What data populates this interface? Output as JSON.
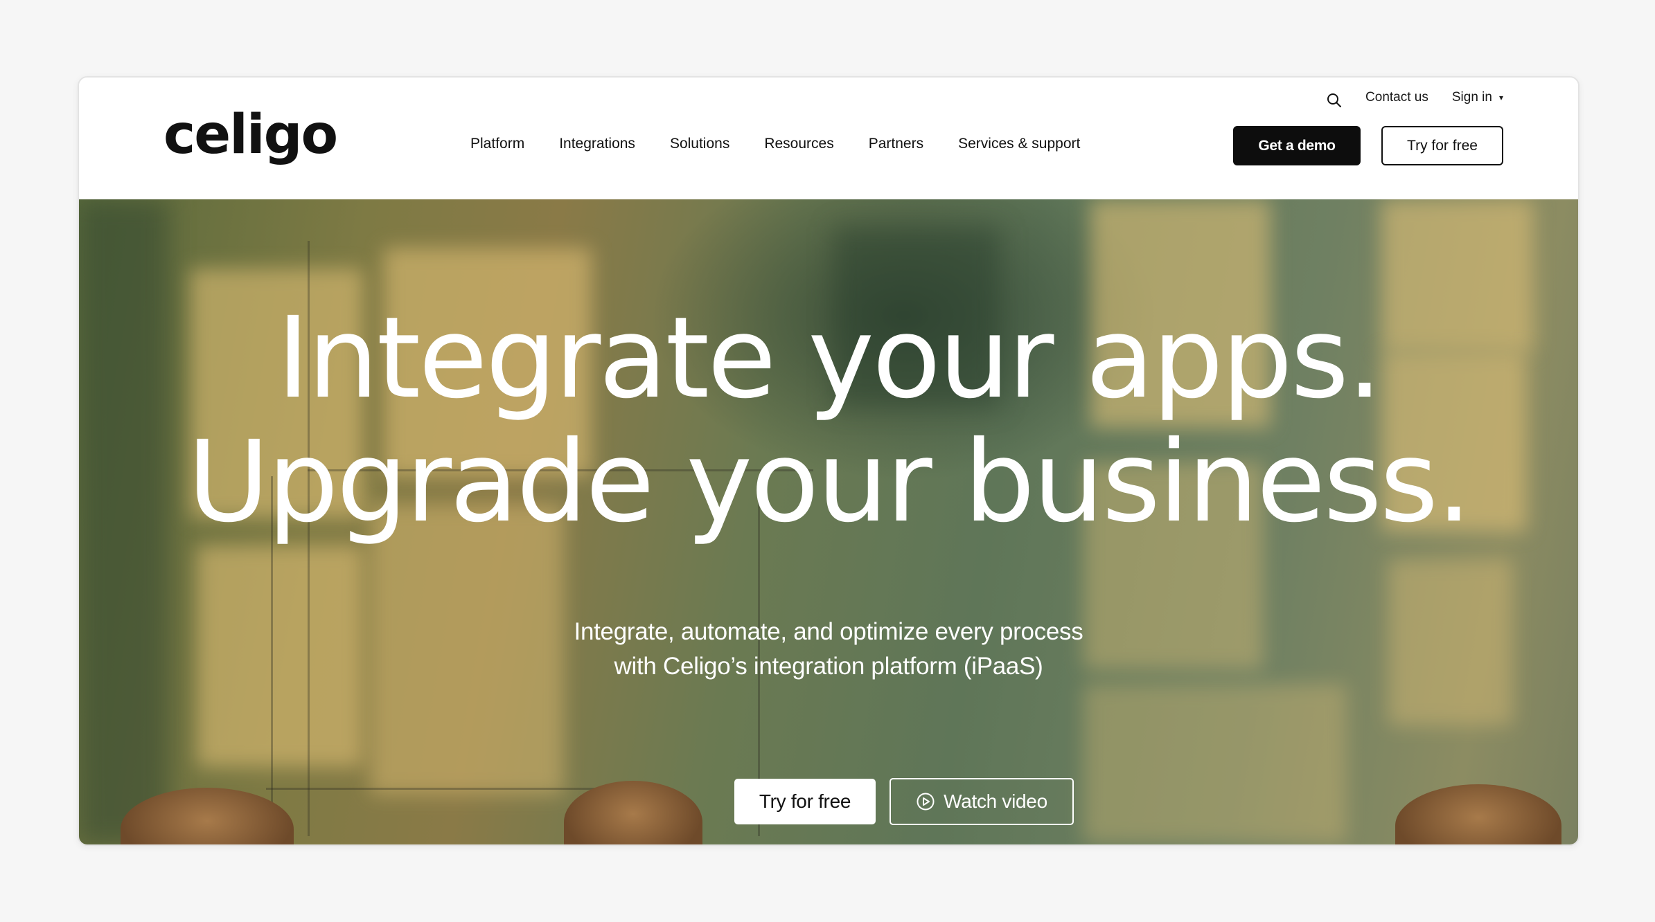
{
  "header": {
    "logo": "celigo",
    "utility": {
      "search_icon": "search-icon",
      "contact": "Contact us",
      "sign_in": "Sign in",
      "sign_in_caret": "▾"
    },
    "nav": [
      "Platform",
      "Integrations",
      "Solutions",
      "Resources",
      "Partners",
      "Services & support"
    ],
    "demo_button": "Get a demo",
    "try_button": "Try for free"
  },
  "hero": {
    "headline_line1": "Integrate your apps.",
    "headline_line2": "Upgrade your business.",
    "subtitle_line1": "Integrate, automate, and optimize every process",
    "subtitle_line2": "with Celigo’s integration platform (iPaaS)",
    "try_button": "Try for free",
    "watch_button": "Watch video",
    "watch_icon": "play-circle-icon"
  },
  "colors": {
    "page_background": "#f6f6f6",
    "primary_button": "#0d0d0d",
    "hero_green": "#5f7658",
    "hero_warm_light": "#e8c478"
  }
}
